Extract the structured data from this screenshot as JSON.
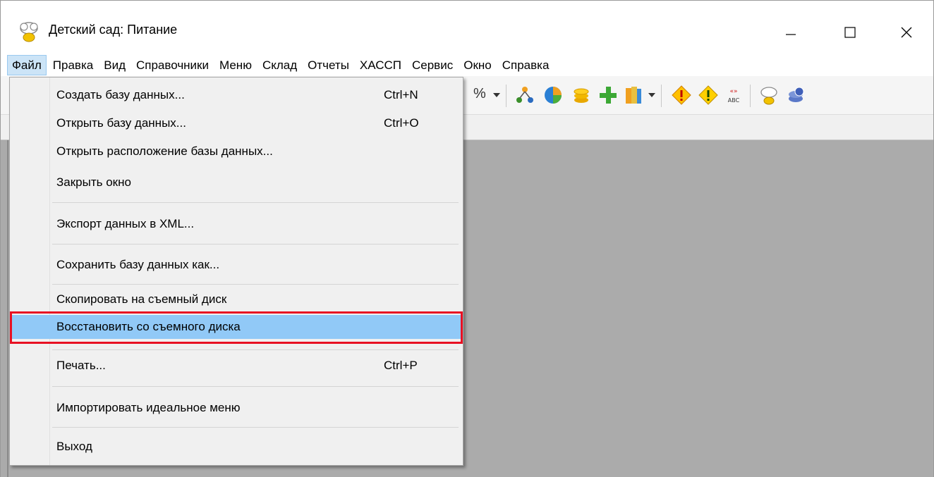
{
  "window": {
    "title": "Детский сад: Питание",
    "controls": {
      "minimize": "—",
      "maximize": "☐",
      "close": "✕"
    }
  },
  "menubar": {
    "items": [
      "Файл",
      "Правка",
      "Вид",
      "Справочники",
      "Меню",
      "Склад",
      "Отчеты",
      "ХАССП",
      "Сервис",
      "Окно",
      "Справка"
    ],
    "active": "Файл"
  },
  "toolbar": {
    "percent_label": "%",
    "icons": [
      "structure-icon",
      "pie-chart-icon",
      "coins-icon",
      "add-plus-icon",
      "book-icon",
      "warning-diamond-icon",
      "info-diamond-icon",
      "abc-spelling-icon",
      "chef-hat-icon",
      "database-icon"
    ]
  },
  "file_menu": {
    "items": [
      {
        "label": "Создать базу данных...",
        "shortcut": "Ctrl+N"
      },
      {
        "label": "Открыть базу данных...",
        "shortcut": "Ctrl+O"
      },
      {
        "label": "Открыть расположение базы данных...",
        "shortcut": ""
      },
      {
        "label": "Закрыть окно",
        "shortcut": ""
      },
      {
        "label": "Экспорт данных в XML...",
        "shortcut": ""
      },
      {
        "label": "Сохранить базу данных как...",
        "shortcut": ""
      },
      {
        "label": "Скопировать на съемный диск",
        "shortcut": ""
      },
      {
        "label": "Восстановить со съемного диска",
        "shortcut": "",
        "selected": true
      },
      {
        "label": "Печать...",
        "shortcut": "Ctrl+P"
      },
      {
        "label": "Импортировать идеальное меню",
        "shortcut": ""
      },
      {
        "label": "Выход",
        "shortcut": ""
      }
    ]
  },
  "colors": {
    "selection": "#91c9f7",
    "highlight_border": "#e81123",
    "workspace": "#ababab",
    "menu_active": "#cce4f7"
  }
}
